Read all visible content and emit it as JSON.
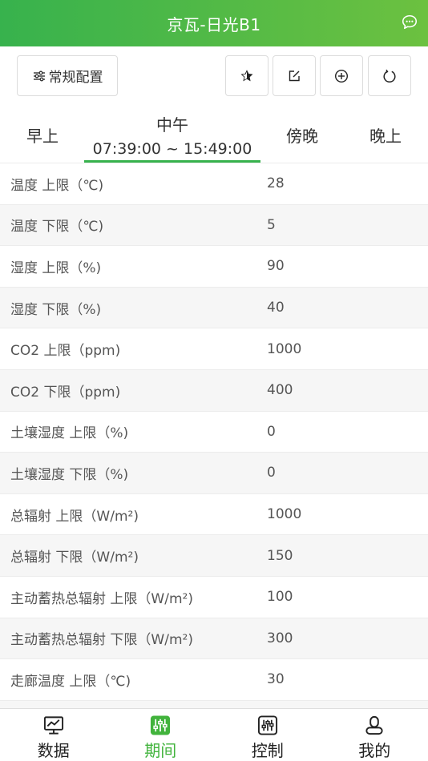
{
  "header": {
    "title": "京瓦-日光B1",
    "chat_icon": "chat-bubble-icon"
  },
  "toolbar": {
    "config_label": "常规配置",
    "config_icon": "sliders-icon",
    "icons": [
      "star-icon",
      "edit-icon",
      "plus-circle-icon",
      "refresh-icon"
    ]
  },
  "tabs": [
    {
      "label": "早上",
      "time": ""
    },
    {
      "label": "中午",
      "time": "07:39:00 ~ 15:49:00",
      "active": true
    },
    {
      "label": "傍晚",
      "time": ""
    },
    {
      "label": "晚上",
      "time": ""
    }
  ],
  "rows": [
    {
      "label": "温度 上限（℃)",
      "value": "28"
    },
    {
      "label": "温度 下限（℃)",
      "value": "5"
    },
    {
      "label": "湿度 上限（%)",
      "value": "90"
    },
    {
      "label": "湿度 下限（%)",
      "value": "40"
    },
    {
      "label": "CO2 上限（ppm)",
      "value": "1000"
    },
    {
      "label": "CO2 下限（ppm)",
      "value": "400"
    },
    {
      "label": "土壤湿度 上限（%)",
      "value": "0"
    },
    {
      "label": "土壤湿度 下限（%)",
      "value": "0"
    },
    {
      "label": "总辐射 上限（W/m²)",
      "value": "1000"
    },
    {
      "label": "总辐射 下限（W/m²)",
      "value": "150"
    },
    {
      "label": "主动蓄热总辐射 上限（W/m²)",
      "value": "100"
    },
    {
      "label": "主动蓄热总辐射 下限（W/m²)",
      "value": "300"
    },
    {
      "label": "走廊温度 上限（℃)",
      "value": "30"
    },
    {
      "label": "",
      "value": ""
    }
  ],
  "bottom_nav": [
    {
      "label": "数据",
      "icon": "monitor-chart-icon"
    },
    {
      "label": "期间",
      "icon": "equalizer-icon",
      "active": true
    },
    {
      "label": "控制",
      "icon": "control-panel-icon"
    },
    {
      "label": "我的",
      "icon": "user-icon"
    }
  ],
  "colors": {
    "accent": "#41b33c",
    "header_start": "#37b24d",
    "header_end": "#6cc140"
  }
}
